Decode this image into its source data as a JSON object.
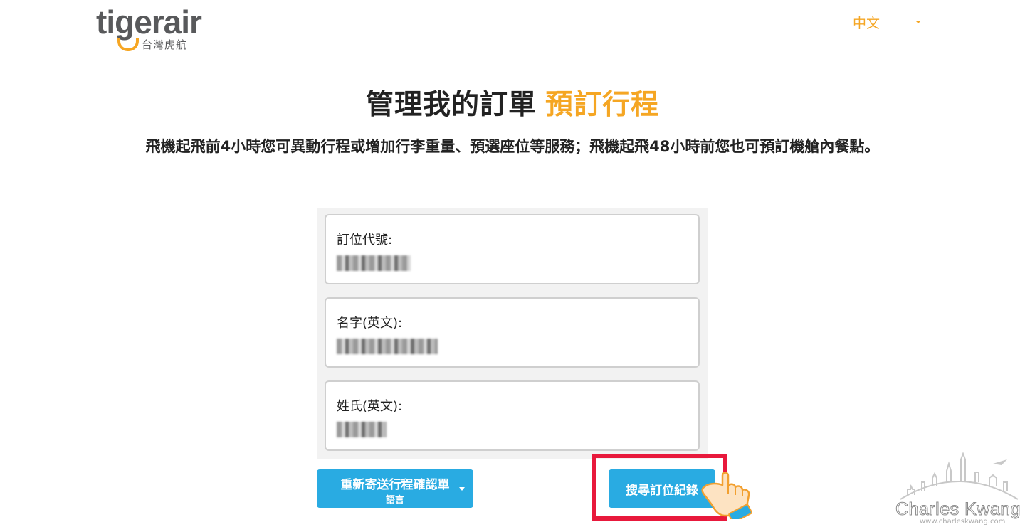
{
  "header": {
    "logo_word": "tigerair",
    "logo_sub": "台灣虎航",
    "language": "中文"
  },
  "page": {
    "title": "管理我的訂單",
    "title_accent": "預訂行程",
    "description": "飛機起飛前4小時您可異動行程或增加行李重量、預選座位等服務；飛機起飛48小時前您也可預訂機艙內餐點。"
  },
  "form": {
    "fields": [
      {
        "label": "訂位代號:",
        "value": "████████"
      },
      {
        "label": "名字(英文):",
        "value": "███████████"
      },
      {
        "label": "姓氏(英文):",
        "value": "█████"
      }
    ]
  },
  "buttons": {
    "resend_label": "重新寄送行程確認單",
    "resend_sub": "語言",
    "search_label": "搜尋訂位紀錄"
  },
  "watermark": {
    "name": "Charles Kwang",
    "url": "www.charleskwang.com"
  },
  "colors": {
    "accent": "#f5a623",
    "button": "#29abe2",
    "highlight": "#e8193c"
  }
}
